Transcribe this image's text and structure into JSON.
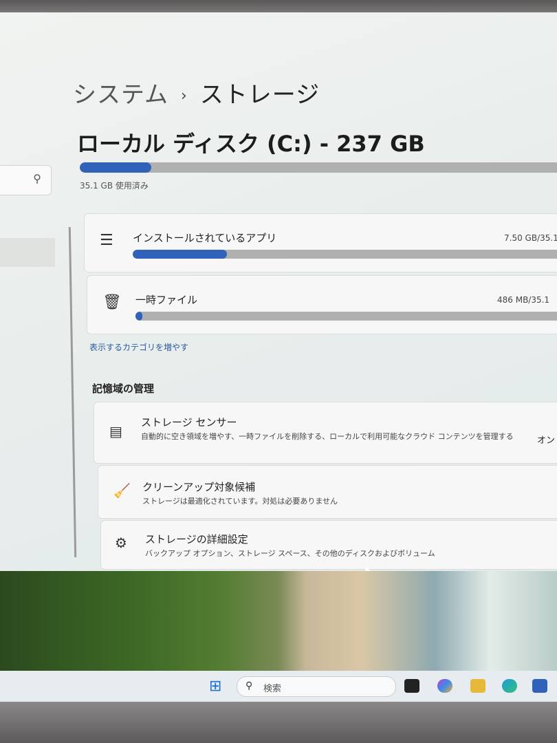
{
  "breadcrumb": {
    "parent": "システム",
    "separator": "›",
    "current": "ストレージ"
  },
  "disk": {
    "title": "ローカル ディスク (C:) - 237 GB",
    "used_text": "35.1 GB 使用済み",
    "used_fraction": 0.148
  },
  "categories": [
    {
      "icon": "list-icon",
      "label": "インストールされているアプリ",
      "size": "7.50 GB/35.1",
      "fraction": 0.214
    },
    {
      "icon": "trash-icon",
      "label": "一時ファイル",
      "size": "486 MB/35.1",
      "fraction": 0.014
    }
  ],
  "more_categories_link": "表示するカテゴリを増やす",
  "section_title": "記憶域の管理",
  "management": {
    "storage_sense": {
      "title": "ストレージ センサー",
      "desc": "自動的に空き領域を増やす、一時ファイルを削除する、ローカルで利用可能なクラウド コンテンツを管理する",
      "state": "オン"
    },
    "cleanup": {
      "title": "クリーンアップ対象候補",
      "desc": "ストレージは最適化されています。対処は必要ありません"
    },
    "advanced": {
      "title": "ストレージの詳細設定",
      "desc": "バックアップ オプション、ストレージ スペース、その他のディスクおよびボリューム"
    }
  },
  "taskbar": {
    "search_placeholder": "検索"
  },
  "colors": {
    "accent": "#2f62b8",
    "bar_track": "#b0b0b0"
  }
}
